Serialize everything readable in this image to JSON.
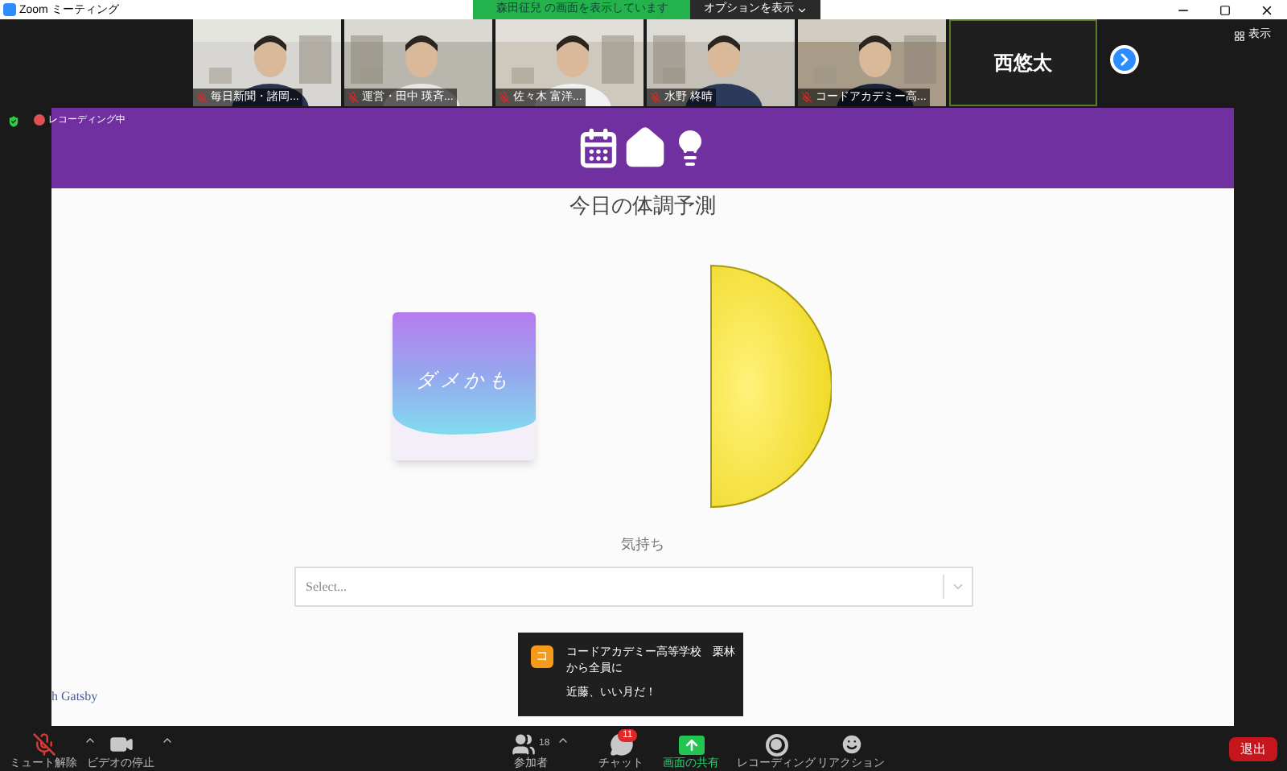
{
  "window": {
    "title": "Zoom ミーティング"
  },
  "share_banner": {
    "text": "森田征兒 の画面を表示しています",
    "options": "オプションを表示"
  },
  "view_button": "表示",
  "participants": [
    {
      "kind": "video",
      "name": "毎日新聞・諸岡..."
    },
    {
      "kind": "video",
      "name": "運営・田中 瑛斉..."
    },
    {
      "kind": "video",
      "name": "佐々木 富洋..."
    },
    {
      "kind": "video",
      "name": "水野 柊晴"
    },
    {
      "kind": "video",
      "name": "コードアカデミー高..."
    },
    {
      "kind": "name",
      "name": "西悠太"
    }
  ],
  "recording": "レコーディング中",
  "page": {
    "title": "今日の体調予測",
    "card_text": "ダメかも",
    "feeling_label": "気持ち",
    "select": {
      "placeholder": "Select..."
    },
    "footer": "h Gatsby"
  },
  "chat_notification": {
    "avatar": "コ",
    "sender": "コードアカデミー高等学校　栗林",
    "recipient": "から全員に",
    "message": "近藤、いい月だ！"
  },
  "toolbar": [
    {
      "kind": "mic",
      "label": "ミュート解除",
      "muted": true
    },
    {
      "kind": "video",
      "label": "ビデオの停止"
    },
    {
      "kind": "participants",
      "label": "参加者",
      "count": "18"
    },
    {
      "kind": "chat",
      "label": "チャット",
      "badge": "11"
    },
    {
      "kind": "share",
      "label": "画面の共有"
    },
    {
      "kind": "record",
      "label": "レコーディング"
    },
    {
      "kind": "reaction",
      "label": "リアクション"
    }
  ],
  "leave_button": "退出"
}
